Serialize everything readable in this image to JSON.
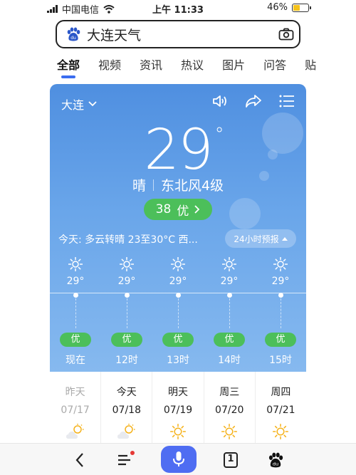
{
  "status_bar": {
    "carrier": "中国电信",
    "time": "上午 11:33",
    "battery": "46%"
  },
  "search": {
    "query": "大连天气",
    "icons": [
      "baidu-paw-icon",
      "camera-icon"
    ]
  },
  "tabs": [
    {
      "label": "全部",
      "active": true
    },
    {
      "label": "视频"
    },
    {
      "label": "资讯"
    },
    {
      "label": "热议"
    },
    {
      "label": "图片"
    },
    {
      "label": "问答"
    },
    {
      "label": "贴"
    }
  ],
  "weather": {
    "city": "大连",
    "temperature": "29",
    "degree_symbol": "°",
    "condition": "晴",
    "wind": "东北风4级",
    "aqi_value": "38",
    "aqi_label": "优",
    "today_summary": "今天: 多云转晴 23至30°C 西...",
    "forecast_button": "24小时预报",
    "hourly": [
      {
        "temp": "29°",
        "quality": "优",
        "time": "现在",
        "icon": "sun-icon"
      },
      {
        "temp": "29°",
        "quality": "优",
        "time": "12时",
        "icon": "sun-icon"
      },
      {
        "temp": "29°",
        "quality": "优",
        "time": "13时",
        "icon": "sun-icon"
      },
      {
        "temp": "29°",
        "quality": "优",
        "time": "14时",
        "icon": "sun-icon"
      },
      {
        "temp": "29°",
        "quality": "优",
        "time": "15时",
        "icon": "sun-icon"
      }
    ],
    "daily": [
      {
        "weekday": "昨天",
        "date": "07/17",
        "icon": "partly-cloudy-icon",
        "past": true
      },
      {
        "weekday": "今天",
        "date": "07/18",
        "icon": "partly-cloudy-icon"
      },
      {
        "weekday": "明天",
        "date": "07/19",
        "icon": "sun-icon"
      },
      {
        "weekday": "周三",
        "date": "07/20",
        "icon": "sun-icon"
      },
      {
        "weekday": "周四",
        "date": "07/21",
        "icon": "sun-icon"
      }
    ]
  },
  "bottom_nav": {
    "tab_count": "1"
  },
  "colors": {
    "accent": "#3a6df0",
    "aqi_green": "#4cbf5a",
    "card_top": "#4f8fe0",
    "mic_bg": "#4f6df2"
  }
}
